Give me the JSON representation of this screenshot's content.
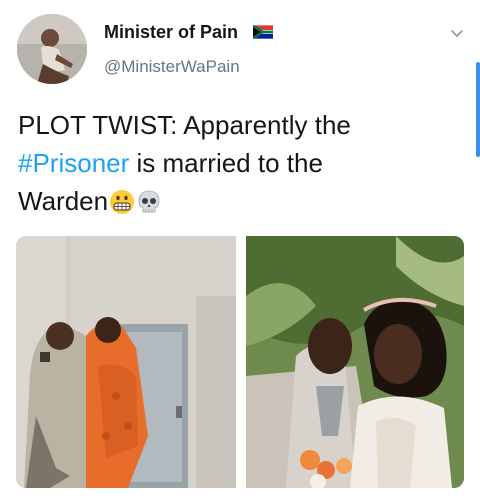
{
  "tweet": {
    "display_name": "Minister of Pain",
    "handle": "@MinisterWaPain",
    "text_before": "PLOT TWIST: Apparently the",
    "hashtag": "#Prisoner",
    "text_after": " is married to the",
    "text_end": "Warden",
    "emojis": [
      "grimacing-face-emoji",
      "skull-emoji"
    ],
    "flag": "south-africa-flag-icon"
  },
  "colors": {
    "hashtag": "#1da1f2",
    "handle": "#657786",
    "scroll": "#3b8fe6"
  }
}
